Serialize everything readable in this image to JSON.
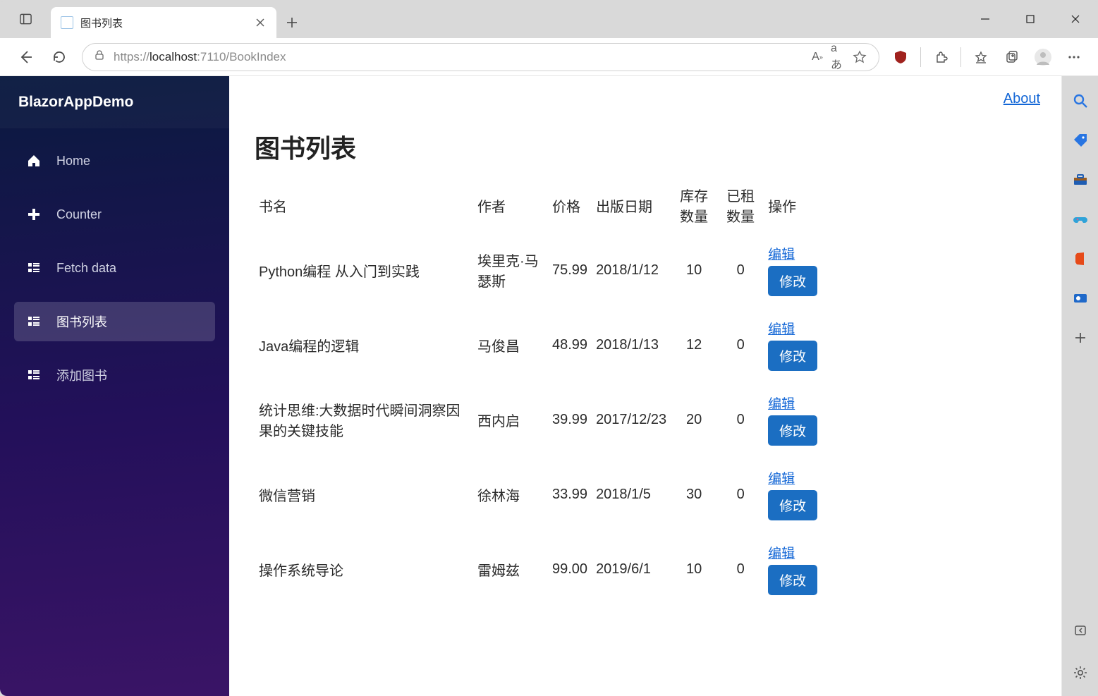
{
  "browser": {
    "tab_title": "图书列表",
    "url_scheme": "https://",
    "url_host": "localhost",
    "url_port": ":7110",
    "url_path": "/BookIndex"
  },
  "app": {
    "brand": "BlazorAppDemo",
    "about_label": "About"
  },
  "sidebar": {
    "items": [
      {
        "label": "Home"
      },
      {
        "label": "Counter"
      },
      {
        "label": "Fetch data"
      },
      {
        "label": "图书列表"
      },
      {
        "label": "添加图书"
      }
    ]
  },
  "page": {
    "title": "图书列表",
    "columns": {
      "title": "书名",
      "author": "作者",
      "price": "价格",
      "pubdate": "出版日期",
      "stock": "库存数量",
      "rented": "已租数量",
      "actions": "操作"
    },
    "actions": {
      "edit": "编辑",
      "modify": "修改"
    },
    "rows": [
      {
        "title": "Python编程 从入门到实践",
        "author": "埃里克·马瑟斯",
        "price": "75.99",
        "pubdate": "2018/1/12",
        "stock": "10",
        "rented": "0"
      },
      {
        "title": "Java编程的逻辑",
        "author": "马俊昌",
        "price": "48.99",
        "pubdate": "2018/1/13",
        "stock": "12",
        "rented": "0"
      },
      {
        "title": "统计思维:大数据时代瞬间洞察因果的关键技能",
        "author": "西内启",
        "price": "39.99",
        "pubdate": "2017/12/23",
        "stock": "20",
        "rented": "0"
      },
      {
        "title": "微信营销",
        "author": "徐林海",
        "price": "33.99",
        "pubdate": "2018/1/5",
        "stock": "30",
        "rented": "0"
      },
      {
        "title": "操作系统导论",
        "author": "雷姆兹",
        "price": "99.00",
        "pubdate": "2019/6/1",
        "stock": "10",
        "rented": "0"
      }
    ]
  }
}
